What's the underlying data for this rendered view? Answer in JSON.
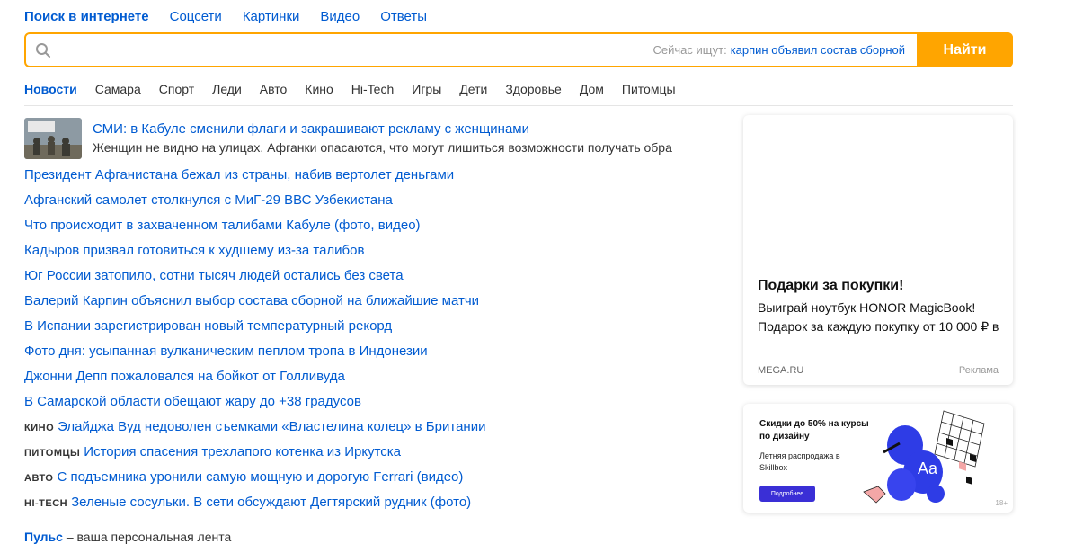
{
  "topnav": {
    "items": [
      "Поиск в интернете",
      "Соцсети",
      "Картинки",
      "Видео",
      "Ответы"
    ]
  },
  "search": {
    "value": "",
    "hint_label": "Сейчас ищут:",
    "hint_query": "карпин объявил состав сборной",
    "button_label": "Найти",
    "icon": "search-icon"
  },
  "tabs": [
    "Новости",
    "Самара",
    "Спорт",
    "Леди",
    "Авто",
    "Кино",
    "Hi-Tech",
    "Игры",
    "Дети",
    "Здоровье",
    "Дом",
    "Питомцы"
  ],
  "lead": {
    "title": "СМИ: в Кабуле сменили флаги и закрашивают рекламу с женщинами",
    "desc": "Женщин не видно на улицах. Афганки опасаются, что могут лишиться возможности получать обра"
  },
  "news": [
    {
      "cat": "",
      "text": "Президент Афганистана бежал из страны, набив вертолет деньгами"
    },
    {
      "cat": "",
      "text": "Афганский самолет столкнулся с МиГ-29 ВВС Узбекистана"
    },
    {
      "cat": "",
      "text": "Что происходит в захваченном талибами Кабуле (фото, видео)"
    },
    {
      "cat": "",
      "text": "Кадыров призвал готовиться к худшему из-за талибов"
    },
    {
      "cat": "",
      "text": "Юг России затопило, сотни тысяч людей остались без света"
    },
    {
      "cat": "",
      "text": "Валерий Карпин объяснил выбор состава сборной на ближайшие матчи"
    },
    {
      "cat": "",
      "text": "В Испании зарегистрирован новый температурный рекорд"
    },
    {
      "cat": "",
      "text": "Фото дня: усыпанная вулканическим пеплом тропа в Индонезии"
    },
    {
      "cat": "",
      "text": "Джонни Депп пожаловался на бойкот от Голливуда"
    },
    {
      "cat": "",
      "text": "В Самарской области обещают жару до +38 градусов"
    },
    {
      "cat": "кино",
      "text": "Элайджа Вуд недоволен съемками «Властелина колец» в Британии"
    },
    {
      "cat": "питомцы",
      "text": "История спасения трехлапого котенка из Иркутска"
    },
    {
      "cat": "авто",
      "text": "С подъемника уронили самую мощную и дорогую Ferrari (видео)"
    },
    {
      "cat": "hi-tech",
      "text": "Зеленые сосульки. В сети обсуждают Дегтярский рудник (фото)"
    }
  ],
  "pulse": {
    "link": "Пульс",
    "text": " – ваша персональная лента"
  },
  "ad1": {
    "heading": "Подарки за покупки!",
    "line1": "Выиграй ноутбук HONOR MagicBook!",
    "line2": "Подарок за каждую покупку от 10 000 ₽ в",
    "domain": "MEGA.RU",
    "label": "Реклама"
  },
  "ad2": {
    "heading": "Скидки до 50% на курсы по дизайну",
    "text": "Летняя распродажа в Skillbox",
    "button": "Подробнее",
    "age": "18+",
    "graphic_text": "Aa"
  },
  "colors": {
    "link": "#005bd1",
    "accent": "#ffa500",
    "ad_button": "#3a2fd6"
  }
}
